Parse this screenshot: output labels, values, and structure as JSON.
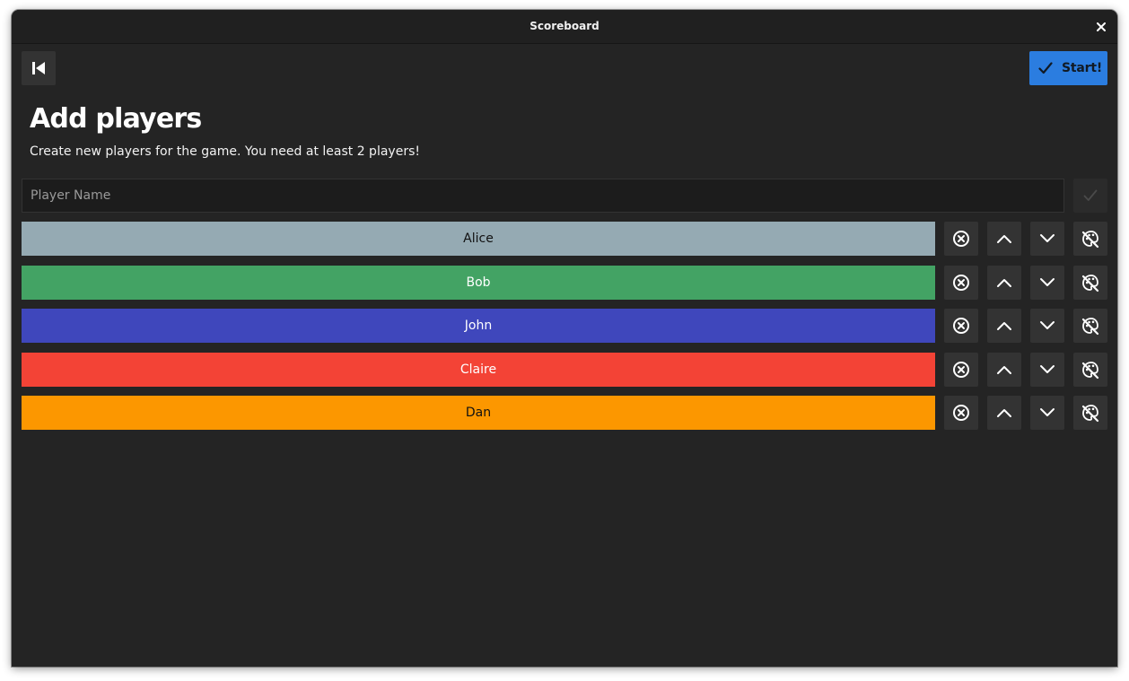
{
  "window": {
    "title": "Scoreboard",
    "close_icon": "close-icon"
  },
  "toolbar": {
    "back_icon": "skip-to-start-icon",
    "start_label": "Start!",
    "start_icon": "checkmark-icon",
    "accent_color": "#2b7de0"
  },
  "header": {
    "title": "Add players",
    "subtitle": "Create new players for the game. You need at least 2 players!"
  },
  "new_player": {
    "value": "",
    "placeholder": "Player Name",
    "confirm_icon": "checkmark-icon"
  },
  "players": [
    {
      "name": "Alice",
      "color": "#95aab3",
      "text_color": "#111111"
    },
    {
      "name": "Bob",
      "color": "#43a364",
      "text_color": "#ffffff"
    },
    {
      "name": "John",
      "color": "#3f47bc",
      "text_color": "#ffffff"
    },
    {
      "name": "Claire",
      "color": "#f34336",
      "text_color": "#ffffff"
    },
    {
      "name": "Dan",
      "color": "#fc9700",
      "text_color": "#111111"
    }
  ],
  "row_actions": {
    "remove_icon": "remove-circle-icon",
    "move_up_icon": "chevron-up-icon",
    "move_down_icon": "chevron-down-icon",
    "color_icon": "palette-icon"
  }
}
